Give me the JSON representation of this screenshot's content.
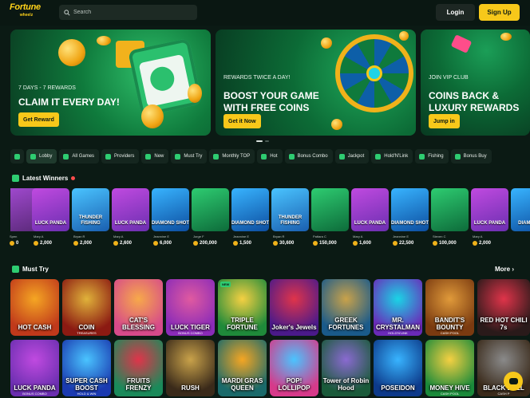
{
  "brand": {
    "line1": "Fortune",
    "line2": "wheelz"
  },
  "search": {
    "placeholder": "Search"
  },
  "auth": {
    "login": "Login",
    "signup": "Sign Up"
  },
  "banners": [
    {
      "subtitle": "7 DAYS - 7 REWARDS",
      "title": "CLAIM IT EVERY DAY!",
      "button": "Get Reward"
    },
    {
      "subtitle": "REWARDS TWICE A DAY!",
      "title_line1": "BOOST YOUR GAME",
      "title_line2": "WITH FREE COINS",
      "button": "Get it Now"
    },
    {
      "subtitle": "JOIN VIP CLUB",
      "title_line1": "COINS BACK &",
      "title_line2": "LUXURY REWARDS",
      "button": "Jump in"
    }
  ],
  "categories": [
    "Lobby",
    "All Games",
    "Providers",
    "New",
    "Must Try",
    "Monthly TOP",
    "Hot",
    "Bonus Combo",
    "Jackpot",
    "Hold'N'Link",
    "Fishing",
    "Bonus Buy"
  ],
  "latest_winners": {
    "title": "Latest Winners",
    "games": [
      "LUCK PANDA",
      "THUNDER FISHING",
      "LUCK PANDA",
      "DIAMOND SHOT",
      "",
      "DIAMOND SHOT",
      "THUNDER FISHING",
      "",
      "LUCK PANDA",
      "DIAMOND SHOT",
      "",
      "LUCK PANDA",
      "DIAMOND"
    ],
    "names": [
      "Spen",
      "Mary A",
      "Bryan R",
      "Mary A",
      "Jeannine E",
      "Jorge F",
      "Jeannine E",
      "Bryan R",
      "Pattara C",
      "Mary A",
      "Jeannine E",
      "Steven C",
      "Mary A"
    ],
    "amounts": [
      "0",
      "2,000",
      "2,000",
      "2,600",
      "6,000",
      "200,000",
      "1,500",
      "30,600",
      "150,000",
      "1,600",
      "22,500",
      "100,000",
      "2,000"
    ]
  },
  "must_try": {
    "title": "Must Try",
    "more": "More",
    "row1": [
      {
        "name": "HOT CASH",
        "sub": ""
      },
      {
        "name": "COIN",
        "sub": "TREASURES"
      },
      {
        "name": "CAT'S BLESSING",
        "sub": ""
      },
      {
        "name": "LUCK TIGER",
        "sub": "BONUS COMBO"
      },
      {
        "name": "TRIPLE FORTUNE",
        "sub": ""
      },
      {
        "name": "Joker's Jewels",
        "sub": ""
      },
      {
        "name": "GREEK FORTUNES",
        "sub": ""
      },
      {
        "name": "MR. CRYSTALMAN",
        "sub": "HOLD'N'LINK"
      },
      {
        "name": "BANDIT'S BOUNTY",
        "sub": "CASH POOL"
      },
      {
        "name": "RED HOT CHILI 7s",
        "sub": ""
      }
    ],
    "row2": [
      {
        "name": "LUCK PANDA",
        "sub": "BONUS COMBO"
      },
      {
        "name": "SUPER CASH BOOST",
        "sub": "HOLD & WIN"
      },
      {
        "name": "FRUITS FRENZY",
        "sub": ""
      },
      {
        "name": "RUSH",
        "sub": ""
      },
      {
        "name": "MARDI GRAS QUEEN",
        "sub": ""
      },
      {
        "name": "POP! LOLLIPOP",
        "sub": ""
      },
      {
        "name": "Tower of Robin Hood",
        "sub": ""
      },
      {
        "name": "POSEIDON",
        "sub": ""
      },
      {
        "name": "MONEY HIVE",
        "sub": "CASH POOL"
      },
      {
        "name": "BLACK BULL",
        "sub": "CASH P"
      }
    ]
  },
  "badge": "NEW",
  "colors": {
    "accent": "#f7c81a",
    "green": "#2ecc71",
    "bg": "#0b1a14"
  }
}
